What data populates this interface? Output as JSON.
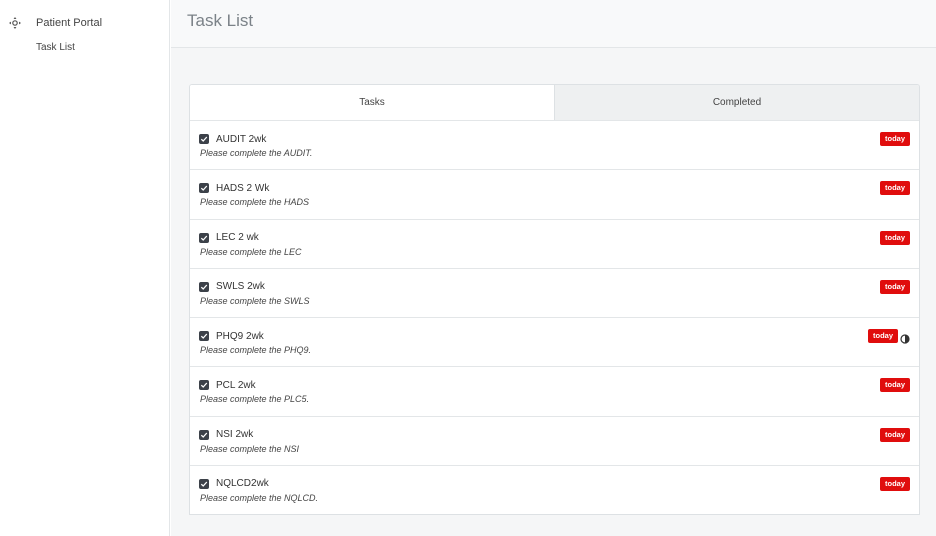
{
  "sidebar": {
    "brand": {
      "label": "Patient Portal",
      "icon": "move-icon"
    },
    "items": [
      {
        "label": "Task List"
      }
    ]
  },
  "header": {
    "title": "Task List"
  },
  "tabs": [
    {
      "label": "Tasks",
      "active": true
    },
    {
      "label": "Completed",
      "active": false
    }
  ],
  "tasks": [
    {
      "title": "AUDIT 2wk",
      "description": "Please complete the AUDIT.",
      "badge": "today",
      "checked": true
    },
    {
      "title": "HADS 2 Wk",
      "description": "Please complete the HADS",
      "badge": "today",
      "checked": true
    },
    {
      "title": "LEC 2 wk",
      "description": "Please complete the LEC",
      "badge": "today",
      "checked": true
    },
    {
      "title": "SWLS 2wk",
      "description": "Please complete the SWLS",
      "badge": "today",
      "checked": true
    },
    {
      "title": "PHQ9 2wk",
      "description": "Please complete the PHQ9.",
      "badge": "today",
      "checked": true,
      "extra_icon": "half-circle-icon"
    },
    {
      "title": "PCL 2wk",
      "description": "Please complete the PLC5.",
      "badge": "today",
      "checked": true
    },
    {
      "title": "NSI 2wk",
      "description": "Please complete the NSI",
      "badge": "today",
      "checked": true
    },
    {
      "title": "NQLCD2wk",
      "description": "Please complete the NQLCD.",
      "badge": "today",
      "checked": true
    }
  ],
  "colors": {
    "badge": "#e00d0d",
    "checkbox": "#3c4149",
    "title_text": "#7b8288"
  }
}
